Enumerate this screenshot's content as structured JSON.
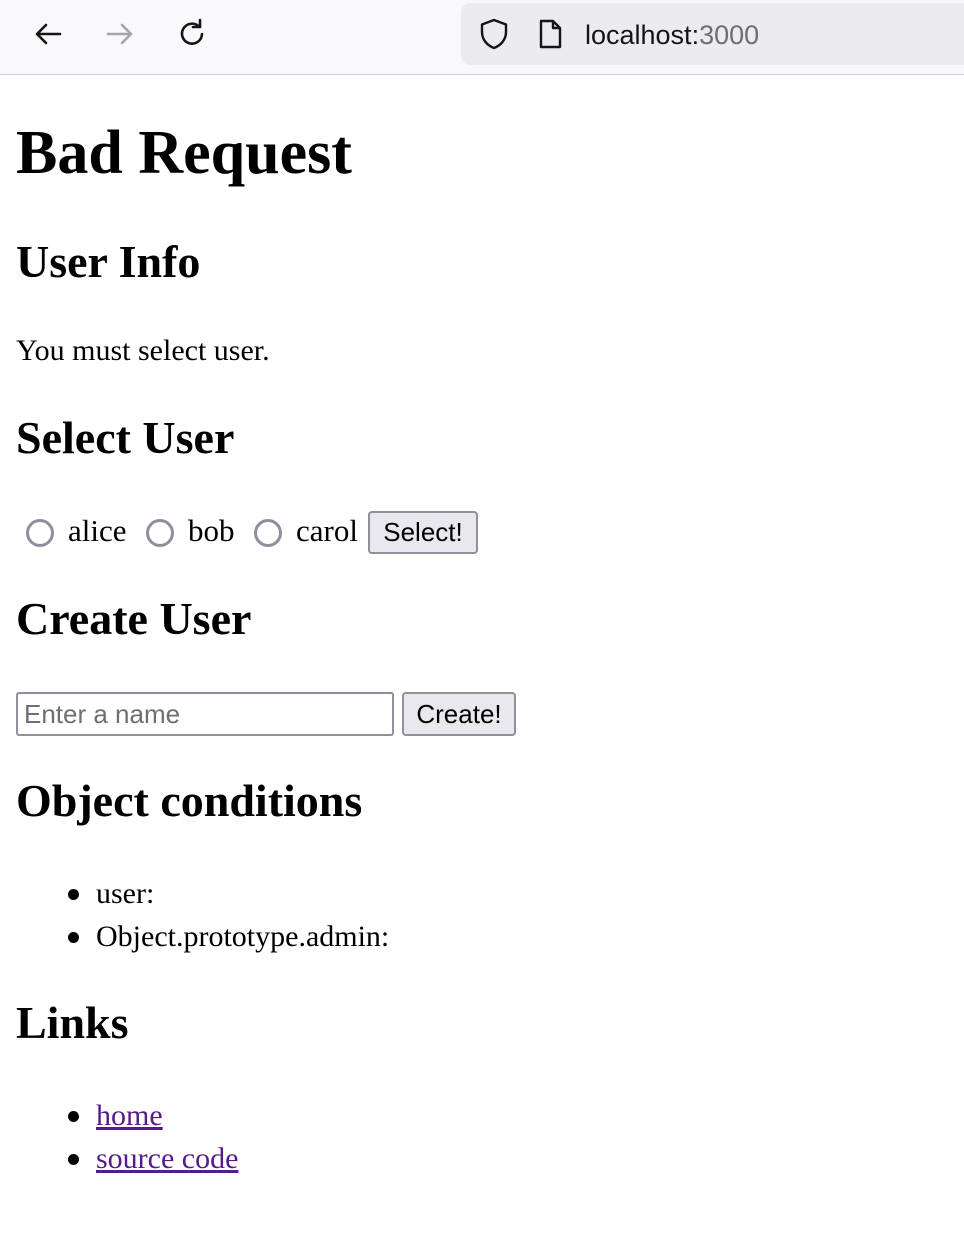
{
  "browser": {
    "url_host": "localhost:",
    "url_port": "3000"
  },
  "page": {
    "title": "Bad Request",
    "user_info": {
      "heading": "User Info",
      "message": "You must select user."
    },
    "select_user": {
      "heading": "Select User",
      "options": [
        "alice",
        "bob",
        "carol"
      ],
      "button_label": "Select!"
    },
    "create_user": {
      "heading": "Create User",
      "input_placeholder": "Enter a name",
      "input_value": "",
      "button_label": "Create!"
    },
    "object_conditions": {
      "heading": "Object conditions",
      "items": [
        "user:",
        "Object.prototype.admin:"
      ]
    },
    "links": {
      "heading": "Links",
      "items": [
        "home",
        "source code"
      ]
    }
  }
}
